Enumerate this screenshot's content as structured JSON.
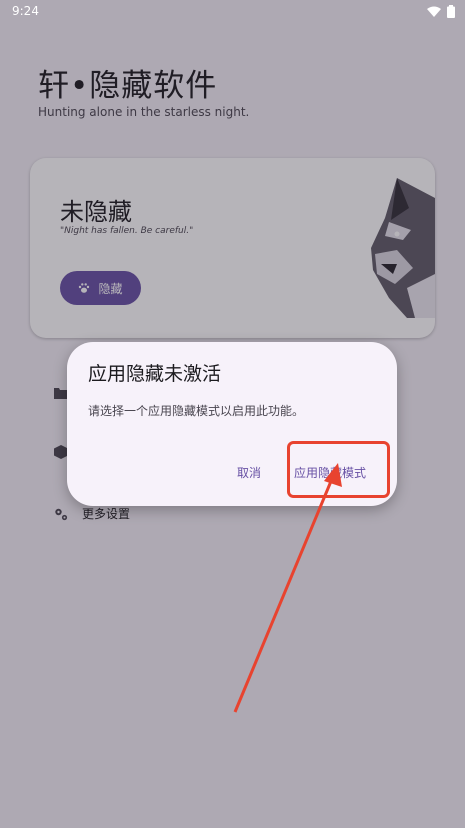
{
  "status_bar": {
    "time": "9:24"
  },
  "header": {
    "title": "轩•隐藏软件",
    "subtitle": "Hunting alone in the starless night."
  },
  "status_card": {
    "state": "未隐藏",
    "quote": "\"Night has fallen. Be careful.\"",
    "hide_button_label": "隐藏"
  },
  "menu": {
    "items": [
      {
        "label": "",
        "icon": "folder-icon"
      },
      {
        "label": "",
        "icon": "cube-icon"
      },
      {
        "label": "更多设置",
        "icon": "gear-icon"
      }
    ]
  },
  "dialog": {
    "title": "应用隐藏未激活",
    "message": "请选择一个应用隐藏模式以启用此功能。",
    "cancel_label": "取消",
    "confirm_label": "应用隐藏模式"
  },
  "colors": {
    "primary": "#6750a4",
    "annotation_red": "#e8432f"
  }
}
